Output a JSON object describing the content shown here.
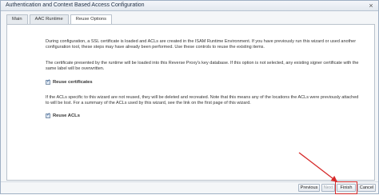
{
  "window": {
    "title": "Authentication and Context Based Access Configuration"
  },
  "tabs": [
    {
      "label": "Main",
      "active": false
    },
    {
      "label": "AAC Runtime",
      "active": false
    },
    {
      "label": "Reuse Options",
      "active": true
    }
  ],
  "content": {
    "paragraph1": "During configuration, a SSL certificate is loaded and ACLs are created in the ISAM Runtime Environment. If you have previously run this wizard or used another configuration tool, these steps may have already been performed. Use these controls to reuse the existing items.",
    "paragraph2": "The certificate presented by the runtime will be loaded into this Reverse Proxy's key database. If this option is not selected, any existing signer certificate with the same label will be overwritten.",
    "reuse_certificates": {
      "label": "Reuse certificates",
      "checked": true
    },
    "paragraph3": "If the ACLs specific to this wizard are not reused, they will be deleted and recreated. Note that this means any of the locations the ACLs were previously attached to will be lost. For a summary of the ACLs used by this wizard, see the link on the first page of this wizard.",
    "reuse_acls": {
      "label": "Reuse ACLs",
      "checked": true
    }
  },
  "footer": {
    "previous": "Previous",
    "next": "Next",
    "finish": "Finish",
    "cancel": "Cancel"
  },
  "annotation": {
    "color": "#d62a2a"
  }
}
